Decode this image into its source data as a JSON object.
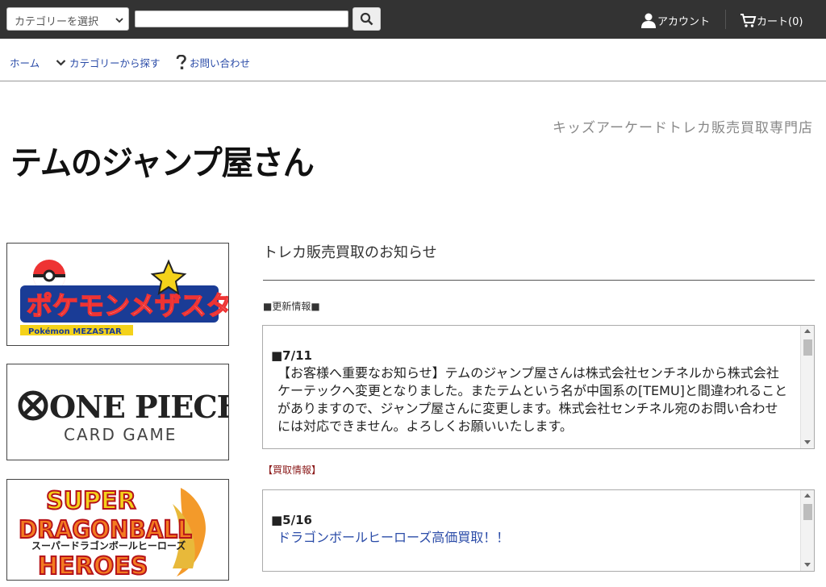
{
  "header": {
    "category_select": "カテゴリーを選択",
    "search_placeholder": "",
    "account_label": "アカウント",
    "cart_label": "カート(0)"
  },
  "nav": {
    "home": "ホーム",
    "category": "カテゴリーから探す",
    "contact": "お問い合わせ"
  },
  "shop": {
    "tagline": "キッズアーケードトレカ販売買取専門店",
    "logo_text": "テムのジャンプ屋さん"
  },
  "banners": [
    {
      "title": "ポケモンメザスタ",
      "subtitle": "Pokémon MEZASTAR"
    },
    {
      "title": "ONE PIECE",
      "subtitle": "CARD GAME"
    },
    {
      "title": "SUPER DRAGONBALL HEROES",
      "subtitle": "スーパードラゴンボールヒーローズ"
    }
  ],
  "main": {
    "title": "トレカ販売買取のお知らせ",
    "update_label": "■更新情報■",
    "update": {
      "date": "■7/11",
      "text": "【お客様へ重要なお知らせ】テムのジャンプ屋さんは株式会社センチネルから株式会社ケーテックへ変更となりました。またテムという名が中国系の[TEMU]と間違われることがありますので、ジャンプ屋さんに変更します。株式会社センチネル宛のお問い合わせには対応できません。よろしくお願いいたします。"
    },
    "buy_label": "【買取情報】",
    "buy": {
      "date": "■5/16",
      "text": "ドラゴンボールヒーローズ高価買取！！"
    }
  },
  "colors": {
    "topbar": "#333333",
    "link": "#2b4ca8",
    "buy_label": "#8b1a1a"
  }
}
